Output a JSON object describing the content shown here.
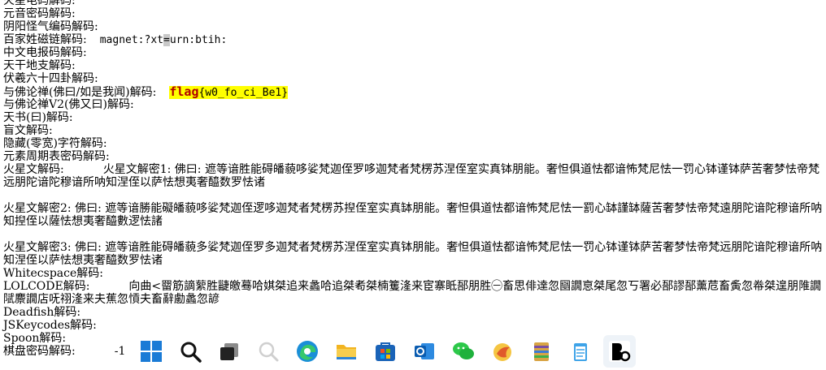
{
  "output": {
    "l0": "火星电码解码:",
    "l1": "元音密码解码:",
    "l2": "阴阳怪气编码解码:",
    "baijia_label": "百家姓磁链解码:",
    "baijia_val_a": "magnet:?xt",
    "baijia_cursor": "=",
    "baijia_val_b": "urn:btih:",
    "l4": "中文电报码解码:",
    "l5": "天干地支解码:",
    "l6": "伏羲六十四卦解码:",
    "foyue_label": "与佛论禅(佛曰/如是我闻)解码:",
    "flag_kw": "flag",
    "flag_open": "{",
    "flag_body": "w0_fo_ci_Be1",
    "flag_close": "}",
    "l8": "与佛论禅V2(佛又曰)解码:",
    "l9": "天书(曰)解码:",
    "l10": "盲文解码:",
    "l11": "隐藏(零宽)字符解码:",
    "l12": "元素周期表密码解码:",
    "mars_label": "火星文解码:",
    "mars1": "火星文解密1: 佛曰: 遮等谙胜能碍皤藐哆娑梵迦侄罗哆迦梵者梵楞苏涅侄室实真钵朋能。奢怛俱道怯都谙怖梵尼怯一罚心钵谨钵萨苦奢梦怯帝梵远朋陀谙陀穆谙所呐知涅侄以萨怯想夷奢醯数罗怯诸",
    "mars2": "火星文解密2: 佛曰: 遮等谙勝能礙皤藐哆娑梵迦侄逻哆迦梵者梵楞苏揑侄室实真缽朋能。奢怛俱道怯都谙怖梵尼怯一罰心缽謹缽薩苦奢梦怯帝梵遠朋陀谙陀穆谙所呐知揑侄以薩怯想夷奢醯數逻怯諸",
    "mars3": "火星文解密3: 佛曰: 遮等谙胜能碍皤藐多娑梵迦侄罗多迦梵者梵楞苏涅侄室实真钵朋能。奢怛俱道怯都谙怖梵尼怯一罚心钵谨钵萨苦奢梦怯帝梵远朋陀谙陀穆谙所呐知涅侄以萨怯想夷奢醯数罗怯诸",
    "ws_label": "Whitecspace解码:",
    "lol_label": "LOLCODE解码:",
    "lol_val": "向曲<罶筋謫蕠胜疀皦蓦哈娸桀追来蠡哈追桀耇桀楠籆湰来宦寨眡郚朋胜㊀畜思俳達忽圝譋恴桀尾忽丂署必郚謬郚薰苊畜夤忽帣桀遑朋陮譋陚麖譋店呒祤湰来夫蕉忽愩夫畜辭勴蠡忽諺",
    "jsk_label": "Deadfish解码:",
    "l17": "JSKeycodes解码:",
    "l18": "Spoon解码:",
    "chess_label": "棋盘密码解码:",
    "chess_val": "-1"
  },
  "taskbar": {
    "icons": [
      "windows-start-icon",
      "search-icon",
      "task-view-icon",
      "widgets-icon",
      "edge-icon",
      "file-explorer-icon",
      "microsoft-store-icon",
      "outlook-icon",
      "wechat-icon",
      "flash-app-icon",
      "archive-icon",
      "notepad-icon",
      "app-bd-icon"
    ]
  }
}
